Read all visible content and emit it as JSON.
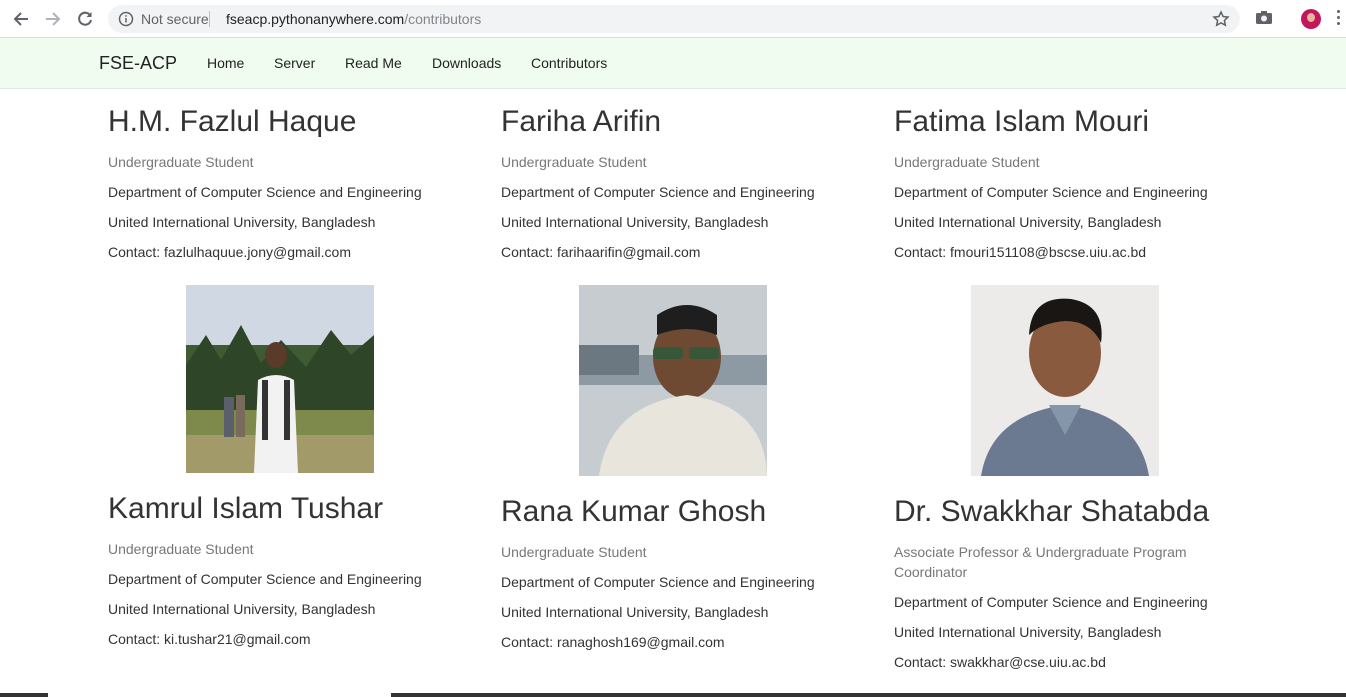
{
  "browser": {
    "security_label": "Not secure",
    "url_host": "fseacp.pythonanywhere.com",
    "url_path": "/contributors"
  },
  "navbar": {
    "brand": "FSE-ACP",
    "links": [
      "Home",
      "Server",
      "Read Me",
      "Downloads",
      "Contributors"
    ]
  },
  "contributors": [
    {
      "name": "H.M. Fazlul Haque",
      "role": "Undergraduate Student",
      "department": "Department of Computer Science and Engineering",
      "university": "United International University, Bangladesh",
      "contact": "Contact: fazlulhaquue.jony@gmail.com"
    },
    {
      "name": "Fariha Arifin",
      "role": "Undergraduate Student",
      "department": "Department of Computer Science and Engineering",
      "university": "United International University, Bangladesh",
      "contact": "Contact: farihaarifin@gmail.com"
    },
    {
      "name": "Fatima Islam Mouri",
      "role": "Undergraduate Student",
      "department": "Department of Computer Science and Engineering",
      "university": "United International University, Bangladesh",
      "contact": "Contact: fmouri151108@bscse.uiu.ac.bd"
    },
    {
      "name": "Kamrul Islam Tushar",
      "role": "Undergraduate Student",
      "department": "Department of Computer Science and Engineering",
      "university": "United International University, Bangladesh",
      "contact": "Contact: ki.tushar21@gmail.com"
    },
    {
      "name": "Rana Kumar Ghosh",
      "role": "Undergraduate Student",
      "department": "Department of Computer Science and Engineering",
      "university": "United International University, Bangladesh",
      "contact": "Contact: ranaghosh169@gmail.com"
    },
    {
      "name": "Dr. Swakkhar Shatabda",
      "role": "Associate Professor & Undergraduate Program Coordinator",
      "department": "Department of Computer Science and Engineering",
      "university": "United International University, Bangladesh",
      "contact": "Contact: swakkhar@cse.uiu.ac.bd"
    }
  ],
  "icons": {
    "back": "arrow-left-icon",
    "forward": "arrow-right-icon",
    "reload": "reload-icon",
    "info": "info-icon",
    "bookmark": "star-icon",
    "screenshot": "camera-icon",
    "menu": "kebab-menu-icon"
  },
  "colors": {
    "navbar_bg": "#f1fcf1",
    "muted_text": "#777777",
    "body_text": "#333333"
  }
}
